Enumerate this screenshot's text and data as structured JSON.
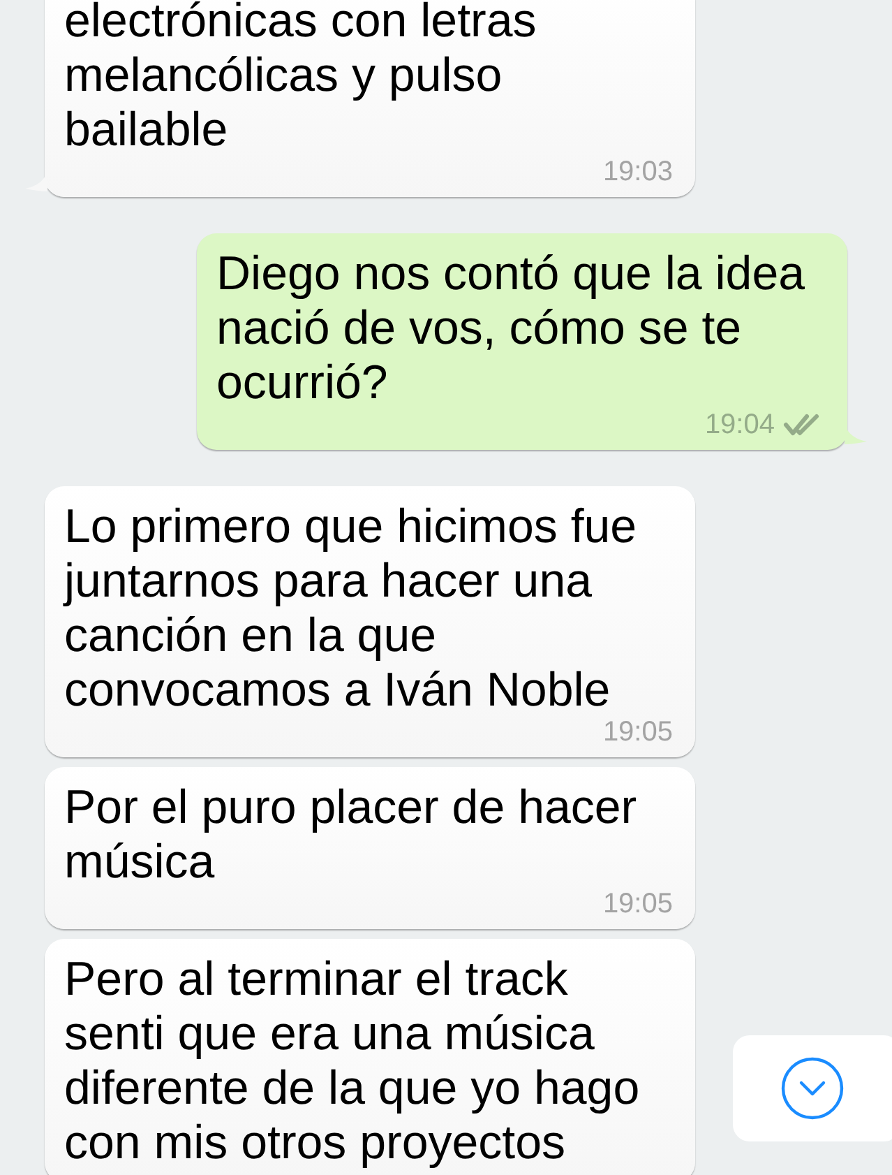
{
  "messages": [
    {
      "kind": "incoming",
      "text": "electrónicas con letras melancólicas y pulso bailable",
      "time": "19:03",
      "tail": true
    },
    {
      "kind": "outgoing",
      "text": "Diego nos contó que la idea nació de vos, cómo se te ocurrió?",
      "time": "19:04",
      "tail": true,
      "delivered": true
    },
    {
      "kind": "incoming",
      "text": "Lo primero que hicimos fue juntarnos para hacer una canción en la que convocamos a Iván Noble",
      "time": "19:05",
      "tail": false
    },
    {
      "kind": "incoming",
      "text": "Por el puro placer de hacer música",
      "time": "19:05",
      "tail": false
    },
    {
      "kind": "incoming",
      "text": "Pero al terminar el track senti que era una música diferente de la que yo hago con mis otros proyectos",
      "tail": false
    }
  ],
  "scroll_down_button": {
    "visible": true
  }
}
